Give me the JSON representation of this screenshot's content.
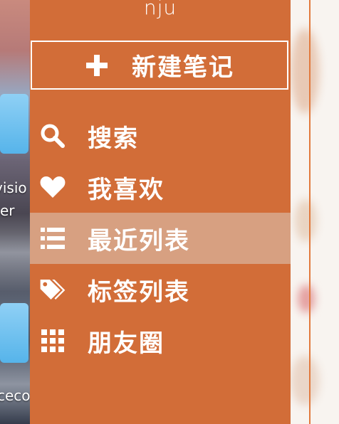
{
  "desktop": {
    "label_1": "visio",
    "label_2": "er",
    "label_3": "ceco"
  },
  "sidebar": {
    "title": "nju",
    "new_note": {
      "label": "新建笔记",
      "icon": "plus-icon"
    },
    "items": [
      {
        "label": "搜索",
        "icon": "search-icon",
        "active": false
      },
      {
        "label": "我喜欢",
        "icon": "heart-icon",
        "active": false
      },
      {
        "label": "最近列表",
        "icon": "list-icon",
        "active": true
      },
      {
        "label": "标签列表",
        "icon": "tags-icon",
        "active": false
      },
      {
        "label": "朋友圈",
        "icon": "grid-icon",
        "active": false
      }
    ]
  },
  "colors": {
    "sidebar_bg": "#d26d38",
    "active_bg": "#d7a081",
    "text": "#ffffff"
  }
}
